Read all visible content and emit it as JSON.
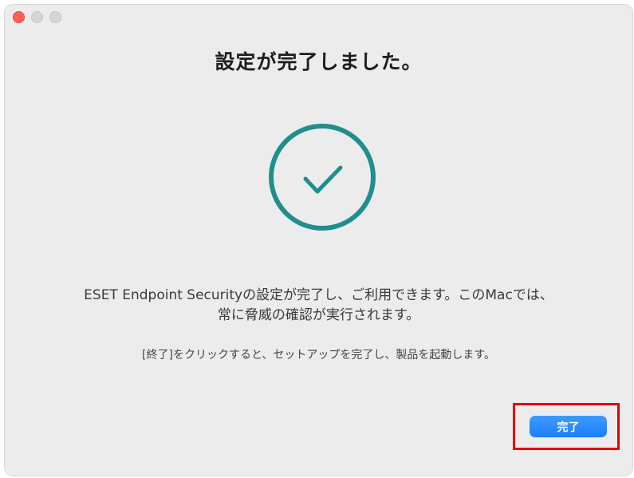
{
  "window": {
    "controls": [
      "close",
      "minimize",
      "zoom"
    ]
  },
  "dialog": {
    "title": "設定が完了しました。",
    "status_icon": "checkmark-circle-icon",
    "message_line1": "ESET Endpoint Securityの設定が完了し、ご利用できます。このMacでは、",
    "message_line2": "常に脅威の確認が実行されます。",
    "hint": "[終了]をクリックすると、セットアップを完了し、製品を起動します。",
    "done_label": "完了"
  },
  "colors": {
    "accent_teal": "#1f8f8c",
    "button_blue": "#1a7ef7",
    "highlight_red": "#e30000",
    "close_red": "#fe5f57"
  }
}
